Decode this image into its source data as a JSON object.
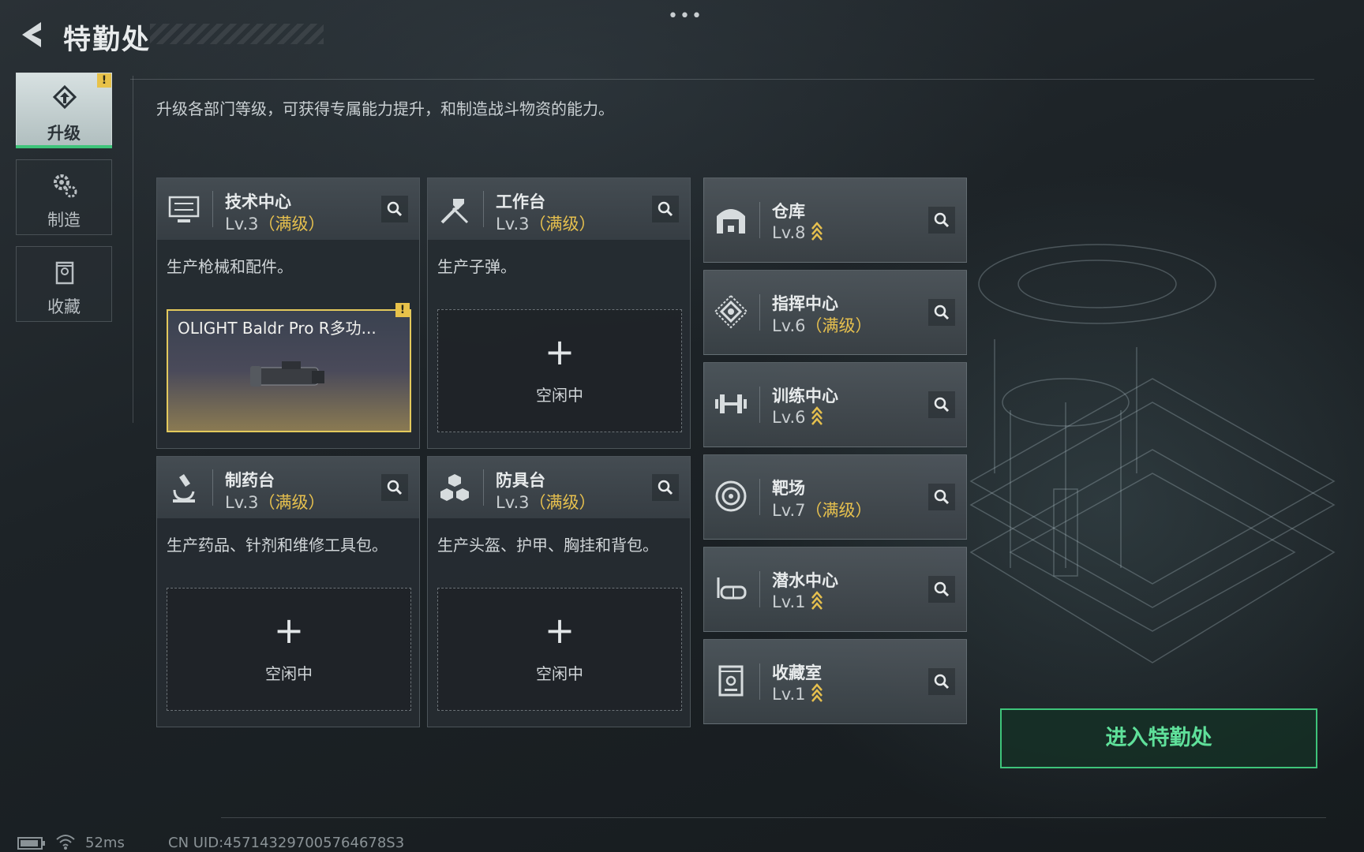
{
  "header": {
    "title": "特勤处"
  },
  "sidebar": {
    "tabs": [
      {
        "label": "升级",
        "icon": "upgrade-icon",
        "active": true,
        "alert": "!"
      },
      {
        "label": "制造",
        "icon": "gears-icon",
        "active": false
      },
      {
        "label": "收藏",
        "icon": "collection-icon",
        "active": false
      }
    ]
  },
  "description": "升级各部门等级，可获得专属能力提升，和制造战斗物资的能力。",
  "stations": [
    {
      "name": "技术中心",
      "level": "Lv.3",
      "max": "（满级）",
      "desc": "生产枪械和配件。",
      "slot": {
        "item": "OLIGHT Baldr Pro R多功...",
        "alert": "!"
      }
    },
    {
      "name": "工作台",
      "level": "Lv.3",
      "max": "（满级）",
      "desc": "生产子弹。",
      "slot": {
        "plus": "+",
        "status": "空闲中"
      }
    },
    {
      "name": "制药台",
      "level": "Lv.3",
      "max": "（满级）",
      "desc": "生产药品、针剂和维修工具包。",
      "slot": {
        "plus": "+",
        "status": "空闲中"
      }
    },
    {
      "name": "防具台",
      "level": "Lv.3",
      "max": "（满级）",
      "desc": "生产头盔、护甲、胸挂和背包。",
      "slot": {
        "plus": "+",
        "status": "空闲中"
      }
    }
  ],
  "facilities": [
    {
      "name": "仓库",
      "level": "Lv.8",
      "max": "",
      "upgradable": true,
      "icon": "warehouse-icon"
    },
    {
      "name": "指挥中心",
      "level": "Lv.6",
      "max": "（满级）",
      "upgradable": false,
      "icon": "command-icon"
    },
    {
      "name": "训练中心",
      "level": "Lv.6",
      "max": "",
      "upgradable": true,
      "icon": "dumbbell-icon"
    },
    {
      "name": "靶场",
      "level": "Lv.7",
      "max": "（满级）",
      "upgradable": false,
      "icon": "target-icon"
    },
    {
      "name": "潜水中心",
      "level": "Lv.1",
      "max": "",
      "upgradable": true,
      "icon": "diving-mask-icon"
    },
    {
      "name": "收藏室",
      "level": "Lv.1",
      "max": "",
      "upgradable": true,
      "icon": "trophy-case-icon"
    }
  ],
  "enter_button": "进入特勤处",
  "status_bar": {
    "ping": "52ms",
    "uid": "CN UID:457143297005764678S3"
  },
  "colors": {
    "accent_green": "#3ec47a",
    "max_gold": "#e6c04e",
    "alert_yellow": "#e8c24a"
  }
}
